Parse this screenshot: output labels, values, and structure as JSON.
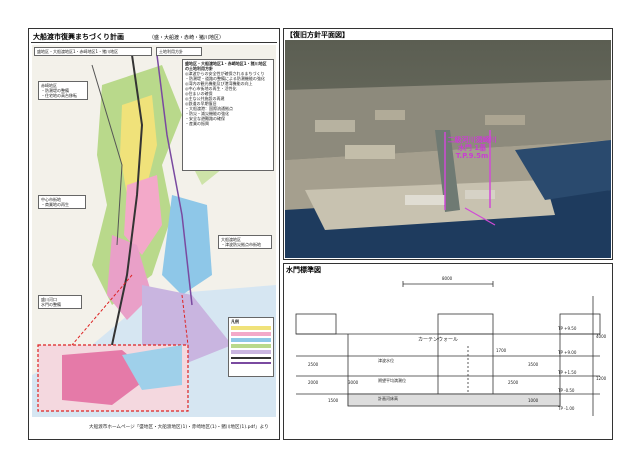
{
  "left_panel": {
    "title": "大船渡市復興まちづくり計画",
    "subtitle": "（盛・大船渡・赤崎・猪川地区）",
    "map_label": "盛地区・大船渡地区1・赤崎地区1・猪川地区",
    "map_label2": "土地利用方針",
    "info_title": "盛地区・大船渡地区1・赤崎地区1・猪川地区",
    "info_sub": "の土地利用方針",
    "info_lines": [
      "◎津波からの安全性が確保されるまちづくり",
      "・防潮堤・道路の整備による防潮機能の強化",
      "◎湾内の観光機能及び港湾機能の向上",
      "◎中心市街地の再生・活性化",
      "◎住まいの確保",
      "◎主な公共施設の再建",
      "◎鉄道の早期復旧",
      "・大船渡港：国際流通拠点",
      "・防災・減災機能の強化",
      "・安全な避難路の確保",
      "・産業の振興"
    ],
    "callouts": [
      "赤崎地区",
      "・防潮堤の整備",
      "・住宅地の高台移転",
      "中心市街地",
      "・商業地の再生",
      "大船渡地区",
      "・津波防災拠点市街地",
      "盛川河口",
      "水門の整備"
    ],
    "legend_title": "凡例",
    "footnote": "大船渡市ホームページ「盛地区・大船渡地区(1)・赤崎地区(1)・猪川地区(1).pdf」より"
  },
  "right_top": {
    "title": "【復旧方針平面図】",
    "photo_label_1": "二級河川須崎川",
    "photo_label_2": "水門 1基",
    "photo_label_3": "T.P.9.5m"
  },
  "right_bottom": {
    "title": "水門標準図",
    "dimension_top": "8000",
    "label_curtain": "カーテンウォール",
    "levels": [
      "TP +9.50",
      "TP +9.00",
      "TP +1.50",
      "TP -0.50",
      "TP -1.00"
    ],
    "dims": [
      "2500",
      "2000",
      "3000",
      "1500",
      "1700",
      "2500",
      "3500",
      "1000",
      "4000",
      "1200"
    ],
    "water_label_1": "津波水位",
    "water_label_2": "朔望平均満潮位",
    "water_label_3": "計画河床高"
  }
}
